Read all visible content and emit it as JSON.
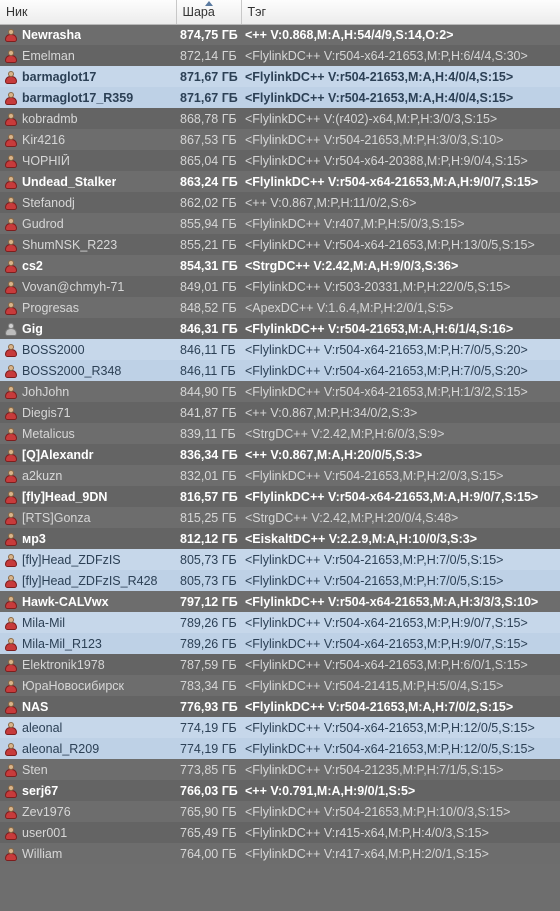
{
  "columns": {
    "nick": "Ник",
    "share": "Шара",
    "tag": "Тэг"
  },
  "rows": [
    {
      "nick": "Newrasha",
      "share": "874,75 ГБ",
      "tag": "<++ V:0.868,M:A,H:54/4/9,S:14,O:2>",
      "bold": true,
      "sel": false,
      "icon": "red"
    },
    {
      "nick": "Emelman",
      "share": "872,14 ГБ",
      "tag": "<FlylinkDC++ V:r504-x64-21653,M:P,H:6/4/4,S:30>",
      "bold": false,
      "sel": false,
      "icon": "red"
    },
    {
      "nick": "barmaglot17",
      "share": "871,67 ГБ",
      "tag": "<FlylinkDC++ V:r504-21653,M:A,H:4/0/4,S:15>",
      "bold": true,
      "sel": true,
      "icon": "red"
    },
    {
      "nick": "barmaglot17_R359",
      "share": "871,67 ГБ",
      "tag": "<FlylinkDC++ V:r504-21653,M:A,H:4/0/4,S:15>",
      "bold": true,
      "sel": true,
      "icon": "red"
    },
    {
      "nick": "kobradmb",
      "share": "868,78 ГБ",
      "tag": "<FlylinkDC++ V:(r402)-x64,M:P,H:3/0/3,S:15>",
      "bold": false,
      "sel": false,
      "icon": "red"
    },
    {
      "nick": "Kir4216",
      "share": "867,53 ГБ",
      "tag": "<FlylinkDC++ V:r504-21653,M:P,H:3/0/3,S:10>",
      "bold": false,
      "sel": false,
      "icon": "red"
    },
    {
      "nick": "ЧОРНІЙ",
      "share": "865,04 ГБ",
      "tag": "<FlylinkDC++ V:r504-x64-20388,M:P,H:9/0/4,S:15>",
      "bold": false,
      "sel": false,
      "icon": "red"
    },
    {
      "nick": "Undead_Stalker",
      "share": "863,24 ГБ",
      "tag": "<FlylinkDC++ V:r504-x64-21653,M:A,H:9/0/7,S:15>",
      "bold": true,
      "sel": false,
      "icon": "red"
    },
    {
      "nick": "Stefanodj",
      "share": "862,02 ГБ",
      "tag": "<++ V:0.867,M:P,H:11/0/2,S:6>",
      "bold": false,
      "sel": false,
      "icon": "red"
    },
    {
      "nick": "Gudrod",
      "share": "855,94 ГБ",
      "tag": "<FlylinkDC++ V:r407,M:P,H:5/0/3,S:15>",
      "bold": false,
      "sel": false,
      "icon": "red"
    },
    {
      "nick": "ShumNSK_R223",
      "share": "855,21 ГБ",
      "tag": "<FlylinkDC++ V:r504-x64-21653,M:P,H:13/0/5,S:15>",
      "bold": false,
      "sel": false,
      "icon": "red"
    },
    {
      "nick": "cs2",
      "share": "854,31 ГБ",
      "tag": "<StrgDC++ V:2.42,M:A,H:9/0/3,S:36>",
      "bold": true,
      "sel": false,
      "icon": "red"
    },
    {
      "nick": "Vovan@chmyh-71",
      "share": "849,01 ГБ",
      "tag": "<FlylinkDC++ V:r503-20331,M:P,H:22/0/5,S:15>",
      "bold": false,
      "sel": false,
      "icon": "red"
    },
    {
      "nick": "Progresas",
      "share": "848,52 ГБ",
      "tag": "<ApexDC++ V:1.6.4,M:P,H:2/0/1,S:5>",
      "bold": false,
      "sel": false,
      "icon": "red"
    },
    {
      "nick": "Gig",
      "share": "846,31 ГБ",
      "tag": "<FlylinkDC++ V:r504-21653,M:A,H:6/1/4,S:16>",
      "bold": true,
      "sel": false,
      "icon": "grey"
    },
    {
      "nick": "BOSS2000",
      "share": "846,11 ГБ",
      "tag": "<FlylinkDC++ V:r504-x64-21653,M:P,H:7/0/5,S:20>",
      "bold": false,
      "sel": true,
      "icon": "red"
    },
    {
      "nick": "BOSS2000_R348",
      "share": "846,11 ГБ",
      "tag": "<FlylinkDC++ V:r504-x64-21653,M:P,H:7/0/5,S:20>",
      "bold": false,
      "sel": true,
      "icon": "red"
    },
    {
      "nick": "JohJohn",
      "share": "844,90 ГБ",
      "tag": "<FlylinkDC++ V:r504-x64-21653,M:P,H:1/3/2,S:15>",
      "bold": false,
      "sel": false,
      "icon": "red"
    },
    {
      "nick": "Diegis71",
      "share": "841,87 ГБ",
      "tag": "<++ V:0.867,M:P,H:34/0/2,S:3>",
      "bold": false,
      "sel": false,
      "icon": "red"
    },
    {
      "nick": "Metalicus",
      "share": "839,11 ГБ",
      "tag": "<StrgDC++ V:2.42,M:P,H:6/0/3,S:9>",
      "bold": false,
      "sel": false,
      "icon": "red"
    },
    {
      "nick": "[Q]Alexandr",
      "share": "836,34 ГБ",
      "tag": "<++ V:0.867,M:A,H:20/0/5,S:3>",
      "bold": true,
      "sel": false,
      "icon": "red"
    },
    {
      "nick": "a2kuzn",
      "share": "832,01 ГБ",
      "tag": "<FlylinkDC++ V:r504-21653,M:P,H:2/0/3,S:15>",
      "bold": false,
      "sel": false,
      "icon": "red"
    },
    {
      "nick": "[fly]Head_9DN",
      "share": "816,57 ГБ",
      "tag": "<FlylinkDC++ V:r504-x64-21653,M:A,H:9/0/7,S:15>",
      "bold": true,
      "sel": false,
      "icon": "red"
    },
    {
      "nick": "[RTS]Gonza",
      "share": "815,25 ГБ",
      "tag": "<StrgDC++ V:2.42,M:P,H:20/0/4,S:48>",
      "bold": false,
      "sel": false,
      "icon": "red"
    },
    {
      "nick": "мр3",
      "share": "812,12 ГБ",
      "tag": "<EiskaltDC++ V:2.2.9,M:A,H:10/0/3,S:3>",
      "bold": true,
      "sel": false,
      "icon": "red"
    },
    {
      "nick": "[fly]Head_ZDFzIS",
      "share": "805,73 ГБ",
      "tag": "<FlylinkDC++ V:r504-21653,M:P,H:7/0/5,S:15>",
      "bold": false,
      "sel": true,
      "icon": "red"
    },
    {
      "nick": "[fly]Head_ZDFzIS_R428",
      "share": "805,73 ГБ",
      "tag": "<FlylinkDC++ V:r504-21653,M:P,H:7/0/5,S:15>",
      "bold": false,
      "sel": true,
      "icon": "red"
    },
    {
      "nick": "Hawk-CALVwx",
      "share": "797,12 ГБ",
      "tag": "<FlylinkDC++ V:r504-x64-21653,M:A,H:3/3/3,S:10>",
      "bold": true,
      "sel": false,
      "icon": "red"
    },
    {
      "nick": "Mila-Mil",
      "share": "789,26 ГБ",
      "tag": "<FlylinkDC++ V:r504-x64-21653,M:P,H:9/0/7,S:15>",
      "bold": false,
      "sel": true,
      "icon": "red"
    },
    {
      "nick": "Mila-Mil_R123",
      "share": "789,26 ГБ",
      "tag": "<FlylinkDC++ V:r504-x64-21653,M:P,H:9/0/7,S:15>",
      "bold": false,
      "sel": true,
      "icon": "red"
    },
    {
      "nick": "Elektronik1978",
      "share": "787,59 ГБ",
      "tag": "<FlylinkDC++ V:r504-x64-21653,M:P,H:6/0/1,S:15>",
      "bold": false,
      "sel": false,
      "icon": "red"
    },
    {
      "nick": "ЮраНовосибирск",
      "share": "783,34 ГБ",
      "tag": "<FlylinkDC++ V:r504-21415,M:P,H:5/0/4,S:15>",
      "bold": false,
      "sel": false,
      "icon": "red"
    },
    {
      "nick": "NAS",
      "share": "776,93 ГБ",
      "tag": "<FlylinkDC++ V:r504-21653,M:A,H:7/0/2,S:15>",
      "bold": true,
      "sel": false,
      "icon": "red"
    },
    {
      "nick": "aleonal",
      "share": "774,19 ГБ",
      "tag": "<FlylinkDC++ V:r504-x64-21653,M:P,H:12/0/5,S:15>",
      "bold": false,
      "sel": true,
      "icon": "red"
    },
    {
      "nick": "aleonal_R209",
      "share": "774,19 ГБ",
      "tag": "<FlylinkDC++ V:r504-x64-21653,M:P,H:12/0/5,S:15>",
      "bold": false,
      "sel": true,
      "icon": "red"
    },
    {
      "nick": "Sten",
      "share": "773,85 ГБ",
      "tag": "<FlylinkDC++ V:r504-21235,M:P,H:7/1/5,S:15>",
      "bold": false,
      "sel": false,
      "icon": "red"
    },
    {
      "nick": "serj67",
      "share": "766,03 ГБ",
      "tag": "<++ V:0.791,M:A,H:9/0/1,S:5>",
      "bold": true,
      "sel": false,
      "icon": "red"
    },
    {
      "nick": "Zev1976",
      "share": "765,90 ГБ",
      "tag": "<FlylinkDC++ V:r504-21653,M:P,H:10/0/3,S:15>",
      "bold": false,
      "sel": false,
      "icon": "red"
    },
    {
      "nick": "user001",
      "share": "765,49 ГБ",
      "tag": "<FlylinkDC++ V:r415-x64,M:P,H:4/0/3,S:15>",
      "bold": false,
      "sel": false,
      "icon": "red"
    },
    {
      "nick": "William",
      "share": "764,00 ГБ",
      "tag": "<FlylinkDC++ V:r417-x64,M:P,H:2/0/1,S:15>",
      "bold": false,
      "sel": false,
      "icon": "red"
    }
  ]
}
